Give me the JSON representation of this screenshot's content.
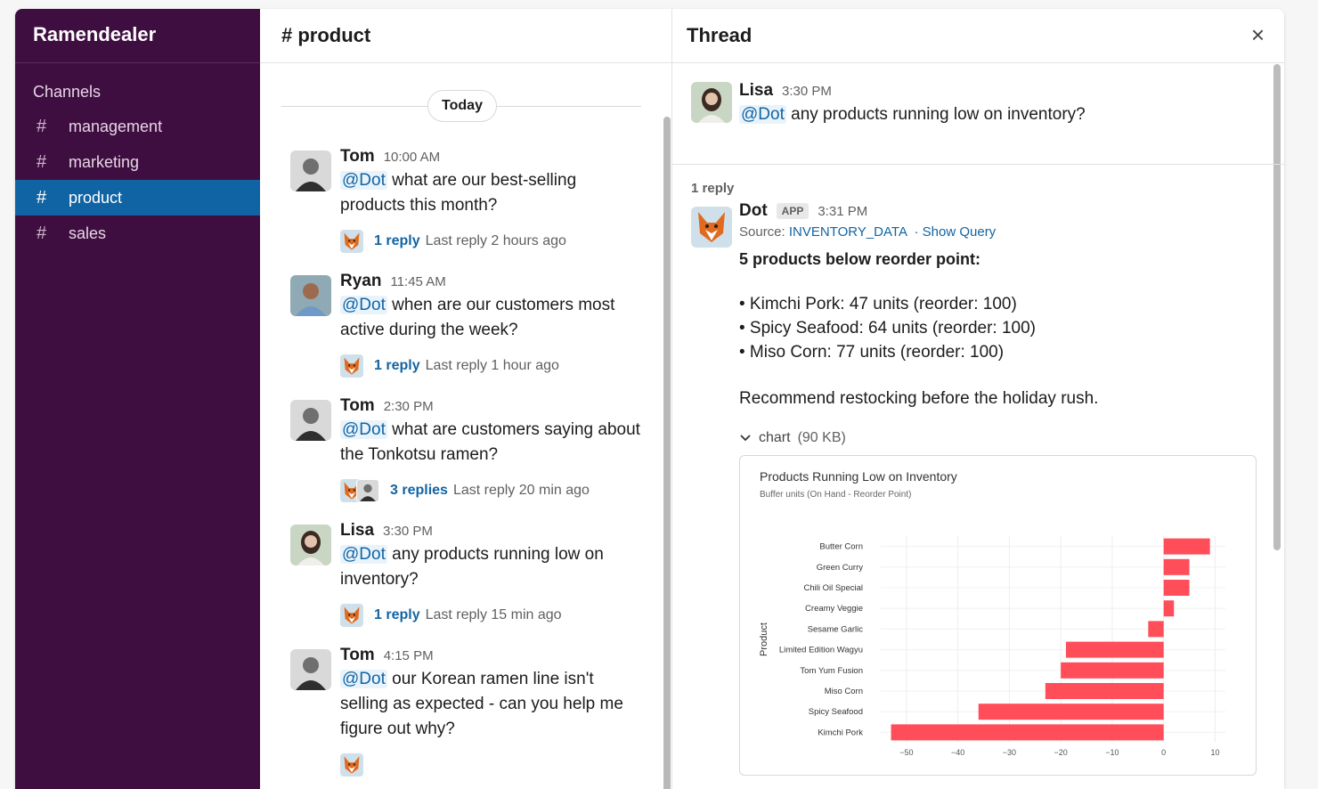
{
  "workspace": "Ramendealer",
  "sidebar": {
    "channels_label": "Channels",
    "channels": [
      {
        "name": "management",
        "active": false
      },
      {
        "name": "marketing",
        "active": false
      },
      {
        "name": "product",
        "active": true
      },
      {
        "name": "sales",
        "active": false
      }
    ]
  },
  "channel": {
    "title": "# product",
    "day": "Today",
    "messages": [
      {
        "author": "Tom",
        "time": "10:00 AM",
        "mention": "@Dot",
        "text": "what are our best-selling products this month?",
        "reply_label": "1 reply",
        "last_reply": "Last reply 2 hours ago"
      },
      {
        "author": "Ryan",
        "time": "11:45 AM",
        "mention": "@Dot",
        "text": "when are our customers most active during the week?",
        "reply_label": "1 reply",
        "last_reply": "Last reply 1 hour ago"
      },
      {
        "author": "Tom",
        "time": "2:30 PM",
        "mention": "@Dot",
        "text": "what are customers saying about the Tonkotsu ramen?",
        "reply_label": "3 replies",
        "last_reply": "Last reply 20 min ago"
      },
      {
        "author": "Lisa",
        "time": "3:30 PM",
        "mention": "@Dot",
        "text": "any products running low on inventory?",
        "reply_label": "1 reply",
        "last_reply": "Last reply 15 min ago"
      },
      {
        "author": "Tom",
        "time": "4:15 PM",
        "mention": "@Dot",
        "text": "our Korean ramen line isn't selling as expected - can you help me figure out why?",
        "reply_label": "",
        "last_reply": ""
      }
    ]
  },
  "thread": {
    "title": "Thread",
    "close_label": "×",
    "root": {
      "author": "Lisa",
      "time": "3:30 PM",
      "mention": "@Dot",
      "text": "any products running low on inventory?"
    },
    "reply_count": "1 reply",
    "reply": {
      "author": "Dot",
      "badge": "APP",
      "time": "3:31 PM",
      "source_label": "Source:",
      "source_value": "INVENTORY_DATA",
      "show_query": "· Show Query",
      "headline": "5 products below reorder point:",
      "bullets": [
        "• Kimchi Pork: 47 units (reorder: 100)",
        "• Spicy Seafood: 64 units (reorder: 100)",
        "• Miso Corn: 77 units (reorder: 100)"
      ],
      "recommendation": "Recommend restocking before the holiday rush.",
      "attachment_name": "chart",
      "attachment_size": "(90 KB)"
    }
  },
  "chart_data": {
    "type": "bar",
    "orientation": "horizontal",
    "title": "Products Running Low on Inventory",
    "subtitle": "Buffer units (On Hand - Reorder Point)",
    "ylabel": "Product",
    "xlabel": "",
    "categories": [
      "Butter Corn",
      "Green Curry",
      "Chili Oil Special",
      "Creamy Veggie",
      "Sesame Garlic",
      "Limited Edition Wagyu",
      "Tom Yum Fusion",
      "Miso Corn",
      "Spicy Seafood",
      "Kimchi Pork"
    ],
    "values": [
      9,
      5,
      5,
      2,
      -3,
      -19,
      -20,
      -23,
      -36,
      -53
    ],
    "xlim": [
      -55,
      12
    ],
    "xticks": [
      -50,
      -40,
      -30,
      -20,
      -10,
      0,
      10
    ],
    "bar_color": "#ff4d5a",
    "grid": true
  }
}
